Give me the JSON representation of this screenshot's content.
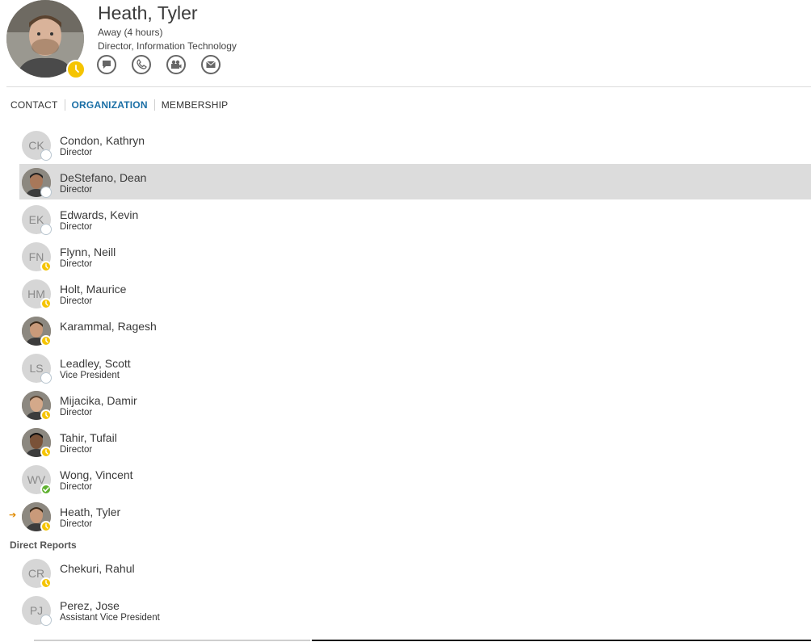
{
  "profile": {
    "name": "Heath, Tyler",
    "status": "Away (4 hours)",
    "title": "Director, Information Technology",
    "presence": "away",
    "actions": [
      {
        "name": "im-icon"
      },
      {
        "name": "phone-icon"
      },
      {
        "name": "video-icon"
      },
      {
        "name": "email-icon"
      }
    ]
  },
  "tabs": [
    {
      "label": "CONTACT",
      "active": false
    },
    {
      "label": "ORGANIZATION",
      "active": true
    },
    {
      "label": "MEMBERSHIP",
      "active": false
    }
  ],
  "peers": [
    {
      "initials": "CK",
      "name": "Condon, Kathryn",
      "role": "Director",
      "presence": "offline",
      "photo": false,
      "selected": false
    },
    {
      "initials": "",
      "name": "DeStefano, Dean",
      "role": "Director",
      "presence": "offline",
      "photo": true,
      "selected": true
    },
    {
      "initials": "EK",
      "name": "Edwards, Kevin",
      "role": "Director",
      "presence": "offline",
      "photo": false,
      "selected": false
    },
    {
      "initials": "FN",
      "name": "Flynn, Neill",
      "role": "Director",
      "presence": "away",
      "photo": false,
      "selected": false
    },
    {
      "initials": "HM",
      "name": "Holt, Maurice",
      "role": "Director",
      "presence": "away",
      "photo": false,
      "selected": false
    },
    {
      "initials": "",
      "name": "Karammal, Ragesh",
      "role": "",
      "presence": "away",
      "photo": true,
      "selected": false
    },
    {
      "initials": "LS",
      "name": "Leadley, Scott",
      "role": "Vice President",
      "presence": "offline",
      "photo": false,
      "selected": false
    },
    {
      "initials": "",
      "name": "Mijacika, Damir",
      "role": "Director",
      "presence": "away",
      "photo": true,
      "selected": false
    },
    {
      "initials": "",
      "name": "Tahir, Tufail",
      "role": "Director",
      "presence": "away",
      "photo": true,
      "selected": false
    },
    {
      "initials": "WV",
      "name": "Wong, Vincent",
      "role": "Director",
      "presence": "available",
      "photo": false,
      "selected": false
    },
    {
      "initials": "",
      "name": "Heath, Tyler",
      "role": "Director",
      "presence": "away",
      "photo": true,
      "selected": false,
      "current": true
    }
  ],
  "direct_reports_heading": "Direct Reports",
  "direct_reports": [
    {
      "initials": "CR",
      "name": "Chekuri, Rahul",
      "role": "",
      "presence": "away",
      "photo": false
    },
    {
      "initials": "PJ",
      "name": "Perez, Jose",
      "role": "Assistant Vice President",
      "presence": "offline",
      "photo": false
    }
  ],
  "colors": {
    "accent": "#1a6fa6",
    "away": "#f5c400",
    "available": "#5fb130",
    "selected_row": "#dcdcdc"
  }
}
